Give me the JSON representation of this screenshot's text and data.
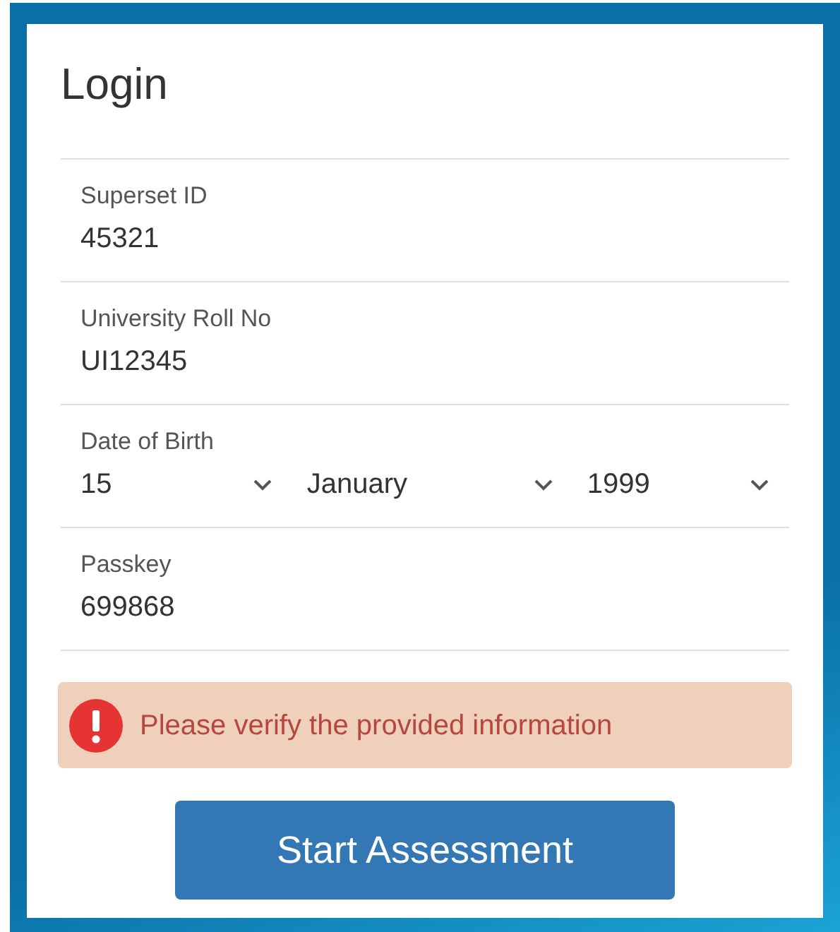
{
  "title": "Login",
  "fields": [
    {
      "kind": "text",
      "label": "Superset ID",
      "value": "45321"
    },
    {
      "kind": "text",
      "label": "University Roll No",
      "value": "UI12345"
    },
    {
      "kind": "selects",
      "label": "Date of Birth",
      "values": [
        "15",
        "January",
        "1999"
      ]
    },
    {
      "kind": "text",
      "label": "Passkey",
      "value": "699868"
    }
  ],
  "alert": {
    "message": "Please verify the provided information"
  },
  "button": "Start Assessment"
}
